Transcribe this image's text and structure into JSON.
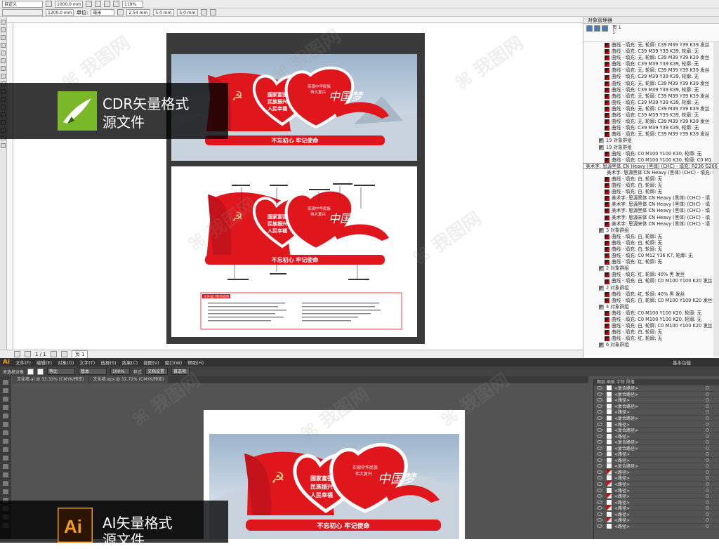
{
  "cdr": {
    "toolbar1": {
      "preset": "自定义",
      "width": "1000.0 mm",
      "height": "1200.0 mm",
      "zoom": "119%"
    },
    "toolbar2": {
      "units_label": "单位:",
      "units_value": "毫米",
      "nudge": "2.54 mm",
      "dup_x": "5.0 mm",
      "dup_y": "5.0 mm"
    },
    "status": {
      "page_of": "1 / 1",
      "page_tab": "页 1"
    },
    "object_manager": {
      "title": "对象管理器",
      "page_label": "页 1",
      "layer_label": "1",
      "rows": [
        "曲线 - 填充: 无, 轮廓: C39 M39 Y39 K39 发丝",
        "曲线 - 填充: C39 M39 Y39 K39, 轮廓: 无",
        "曲线 - 填充: 无, 轮廓: C39 M39 Y39 K39 发丝",
        "曲线 - 填充: C39 M39 Y39 K39, 轮廓: 无",
        "曲线 - 填充: 无, 轮廓: C39 M39 Y39 K39 发丝",
        "曲线 - 填充: C39 M39 Y39 K39, 轮廓: 无",
        "曲线 - 填充: 无, 轮廓: C39 M39 Y39 K39 发丝",
        "曲线 - 填充: C39 M39 Y39 K39, 轮廓: 无",
        "曲线 - 填充: 无, 轮廓: C39 M39 Y39 K39 发丝",
        "曲线 - 填充: C39 M39 Y39 K39, 轮廓: 无",
        "曲线 - 填充: 无, 轮廓: C39 M39 Y39 K39 发丝",
        "曲线 - 填充: C39 M39 Y39 K39, 轮廓: 无",
        "曲线 - 填充: 无, 轮廓: C39 M39 Y39 K39 发丝",
        "曲线 - 填充: C39 M39 Y39 K39, 轮廓: 无",
        "曲线 - 填充: 无, 轮廓: C39 M39 Y39 K39 发丝",
        "19 对象群组",
        "19 对象群组",
        "曲线 - 填充: C0 M100 Y100 K30, 轮廓: 无",
        "曲线 - 填充: C0 M100 Y100 K30, 轮廓: C0 M1",
        "曲线 - 填充: R236 G206 B145, 轮廓: 无",
        "美术字: 思源黑体 CN Heavy (黑体) (CHC) - 填充: R236 G206 B145",
        "曲线 - 填充: 白, 轮廓: 无",
        "曲线 - 填充: 白, 轮廓: 无",
        "曲线 - 填充: 白, 轮廓: 无",
        "美术字: 思源黑体 CN Heavy (黑体) (CHC) - 填",
        "美术字: 思源黑体 CN Heavy (黑体) (CHC) - 填",
        "美术字: 思源黑体 CN Heavy (黑体) (CHC) - 填",
        "美术字: 思源宋体 CN Heavy (黑体) (CHC) - 填",
        "美术字: 思源宋体 CN Heavy (黑体) (CHC) - 填",
        "3 对象群组",
        "曲线 - 填充: 白, 轮廓: 无",
        "曲线 - 填充: 白, 轮廓: 无",
        "曲线 - 填充: 白, 轮廓: 无",
        "曲线 - 填充: C0 M12 Y36 K7, 轮廓: 无",
        "曲线 - 填充: 红, 轮廓: 无",
        "2 对象群组",
        "曲线 - 填充: 红, 轮廓: 40% 黑 发丝",
        "曲线 - 填充: 白, 轮廓: C0 M100 Y100 K20 发丝",
        "2 对象群组",
        "曲线 - 填充: 红, 轮廓: 40% 黑 发丝",
        "曲线 - 填充: 白, 轮廓: C0 M100 Y100 K20 发丝",
        "4 对象群组",
        "曲线 - 填充: C0 M100 Y100 K20, 轮廓: 无",
        "曲线 - 填充: C0 M100 Y100 K20, 轮廓: 无",
        "曲线 - 填充: 白, 轮廓: C0 M100 Y100 K20 发丝",
        "曲线 - 填充: 白, 轮廓: 无",
        "曲线 - 填充: 红, 轮廓: 无",
        "6 对象群组"
      ],
      "tooltip": "美术字: 思源黑体 CN Heavy (黑体) (CHC) - 填充: R236 G206 B145"
    }
  },
  "banner_cdr": {
    "line1": "CDR矢量格式",
    "line2": "源文件"
  },
  "banner_ai": {
    "line1": "AI矢量格式",
    "line2": "源文件"
  },
  "artwork": {
    "slogan": "不忘初心 牢记使命",
    "left_heart": [
      "国家富强",
      "民族振兴",
      "人民幸福"
    ],
    "right_heart": [
      "实现中华民族",
      "伟大复兴"
    ],
    "calligraphy": "中国梦",
    "spec_title": "文件设计制作说明"
  },
  "ai": {
    "menu": [
      "文件(F)",
      "编辑(E)",
      "对象(O)",
      "文字(T)",
      "选择(S)",
      "效果(C)",
      "视图(V)",
      "窗口(W)",
      "帮助(H)"
    ],
    "ctl": {
      "label": "未选择对象",
      "stroke1": "等比",
      "stroke2": "基本",
      "opacity": "100%",
      "style": "样式",
      "doc": "文档设置",
      "pref": "首选项"
    },
    "tabs": [
      "文化墙.ai @ 33.33% (CMYK/预览)",
      "文化墙.eps @ 32.72% (CMYK/预览)"
    ],
    "layers_tabs": "图层  画板  字符  段落",
    "workspace": "基本功能",
    "layer_rows": [
      "<复合路径>",
      "<复合路径>",
      "<路径>",
      "<复合路径>",
      "<路径>",
      "<复合路径>",
      "<路径>",
      "<复合路径>",
      "<路径>",
      "<复合路径>",
      "<复合路径>",
      "<路径>",
      "<路径>",
      "<复合路径>",
      "<路径>",
      "<路径>",
      "<路径>",
      "<路径>",
      "<路径>",
      "<路径>",
      "<路径>",
      "<路径>",
      "<路径>",
      "<路径>"
    ]
  },
  "colors": {
    "red": "#e0161d",
    "dark_red": "#b8101a",
    "gold": "#ecce91"
  }
}
